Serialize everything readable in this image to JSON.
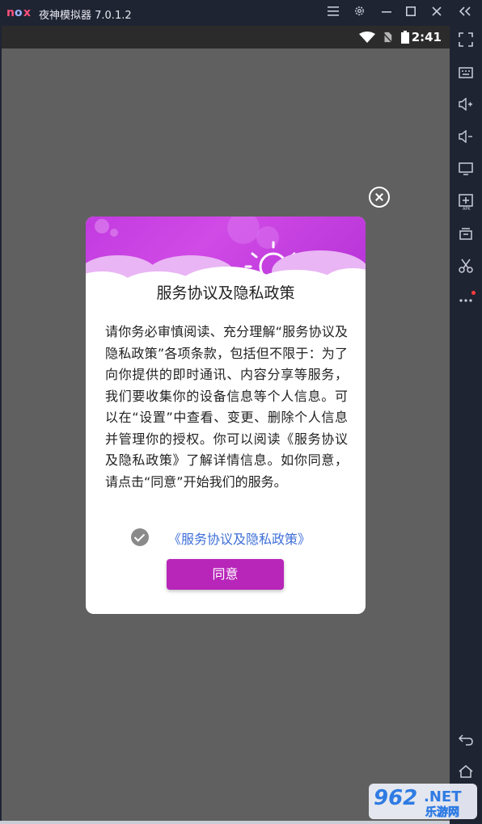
{
  "window": {
    "logo_text": "nox",
    "title": "夜神模拟器 7.0.1.2",
    "controls": [
      "menu-icon",
      "settings-icon",
      "minimize-icon",
      "maximize-icon",
      "close-icon",
      "collapse-icon"
    ]
  },
  "statusbar": {
    "time": "2:41",
    "icons": [
      "wifi-icon",
      "no-sim-icon",
      "battery-icon"
    ]
  },
  "sidebar": {
    "icons": [
      "fullscreen-icon",
      "keyboard-icon",
      "volume-up-icon",
      "volume-down-icon",
      "screen-icon",
      "apk-install-icon",
      "multi-instance-icon",
      "screenshot-scissors-icon",
      "more-icon",
      "back-icon",
      "home-icon"
    ]
  },
  "dialog": {
    "title": "服务协议及隐私政策",
    "body": "请你务必审慎阅读、充分理解“服务协议及隐私政策”各项条款，包括但不限于：为了向你提供的即时通讯、内容分享等服务，我们要收集你的设备信息等个人信息。可以在“设置”中查看、变更、删除个人信息并管理你的授权。你可以阅读《服务协议及隐私政策》了解详情信息。如你同意，请点击“同意”开始我们的服务。",
    "policy_link": "《服务协议及隐私政策》",
    "agree_label": "同意",
    "accent_color": "#b726b9",
    "banner_color": "#c23be0",
    "link_color": "#3f6fd8"
  },
  "watermark": {
    "text_top": "962",
    "text_net": ".NET",
    "text_cn": "乐游网"
  }
}
